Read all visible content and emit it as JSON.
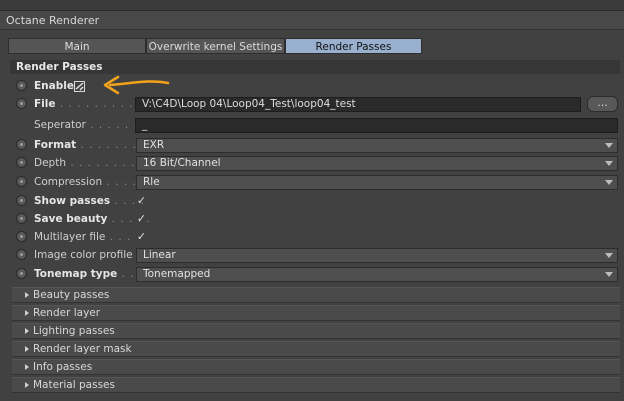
{
  "window": {
    "title": "Octane Renderer"
  },
  "tabs": [
    {
      "label": "Main"
    },
    {
      "label": "Overwrite kernel Settings"
    },
    {
      "label": "Render Passes"
    }
  ],
  "section": {
    "title": "Render Passes"
  },
  "rows": {
    "enable": {
      "label": "Enable",
      "checked": true
    },
    "file": {
      "label": "File",
      "dots": " . . . . . . . . . . . . ",
      "value": "V:\\C4D\\Loop 04\\Loop04_Test\\loop04_test",
      "browse_label": "..."
    },
    "separator": {
      "label": "Seperator",
      "dots": " . . . . . . . ",
      "value": "_"
    },
    "format": {
      "label": "Format",
      "dots": " . . . . . . . . . ",
      "value": "EXR"
    },
    "depth": {
      "label": "Depth",
      "dots": " . . . . . . . . . . ",
      "value": "16 Bit/Channel"
    },
    "compression": {
      "label": "Compression",
      "dots": " . . . . . ",
      "value": "Rle"
    },
    "show_passes": {
      "label": "Show passes",
      "dots": " . . . . ",
      "check": "✓"
    },
    "save_beauty": {
      "label": "Save beauty",
      "dots": " . . . . . ",
      "check": "✓"
    },
    "multilayer": {
      "label": "Multilayer file",
      "dots": " . . . ",
      "check": "✓"
    },
    "color_profile": {
      "label": "Image color profile",
      "value": "Linear"
    },
    "tonemap": {
      "label": "Tonemap type",
      "dots": " . . . . ",
      "value": "Tonemapped"
    }
  },
  "groups": [
    {
      "label": "Beauty passes"
    },
    {
      "label": "Render layer"
    },
    {
      "label": "Lighting passes"
    },
    {
      "label": "Render layer mask"
    },
    {
      "label": "Info passes"
    },
    {
      "label": "Material passes"
    }
  ],
  "colors": {
    "annotation_arrow": "#f2a21b",
    "active_tab": "#9ab0cf"
  }
}
